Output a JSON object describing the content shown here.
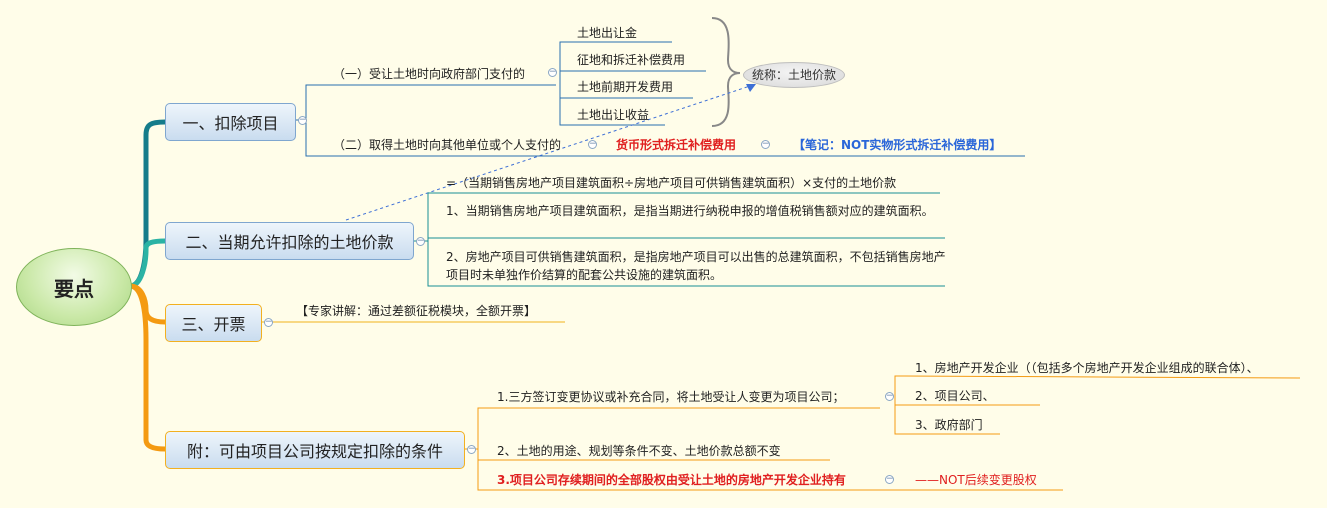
{
  "root": {
    "label": "要点"
  },
  "branch1": {
    "label": "一、扣除项目",
    "child1": {
      "label": "（一）受让土地时向政府部门支付的",
      "items": [
        "土地出让金",
        "征地和拆迁补偿费用",
        "土地前期开发费用",
        "土地出让收益"
      ]
    },
    "child2": {
      "label": "（二）取得土地时向其他单位或个人支付的",
      "red_note": "货币形式拆迁补偿费用",
      "blue_note": "【笔记：NOT实物形式拆迁补偿费用】"
    },
    "summary": "统称：土地价款"
  },
  "branch2": {
    "label": "二、当期允许扣除的土地价款",
    "formula": "=（当期销售房地产项目建筑面积÷房地产项目可供销售建筑面积）×支付的土地价款",
    "note1": "1、当期销售房地产项目建筑面积，是指当期进行纳税申报的增值税销售额对应的建筑面积。",
    "note2": "2、房地产项目可供销售建筑面积，是指房地产项目可以出售的总建筑面积，不包括销售房地产项目时未单独作价结算的配套公共设施的建筑面积。"
  },
  "branch3": {
    "label": "三、开票",
    "note": "【专家讲解：通过差额征税模块，全额开票】"
  },
  "branch4": {
    "label": "附：可由项目公司按规定扣除的条件",
    "cond1": {
      "label": "1.三方签订变更协议或补充合同，将土地受让人变更为项目公司；",
      "items": [
        "1、房地产开发企业（（包括多个房地产开发企业组成的联合体）、",
        "2、项目公司、",
        "3、政府部门"
      ]
    },
    "cond2": "2、土地的用途、规划等条件不变、土地价款总额不变",
    "cond3": "3.项目公司存续期间的全部股权由受让土地的房地产开发企业持有",
    "cond3_note": "——NOT后续变更股权"
  },
  "colors": {
    "background": "#FFFDE9",
    "teal_line": "#1a8f95",
    "blue_line": "#2a6fb0",
    "orange_line": "#f49a12",
    "red_text": "#e02020",
    "blue_text": "#2a66d9"
  }
}
